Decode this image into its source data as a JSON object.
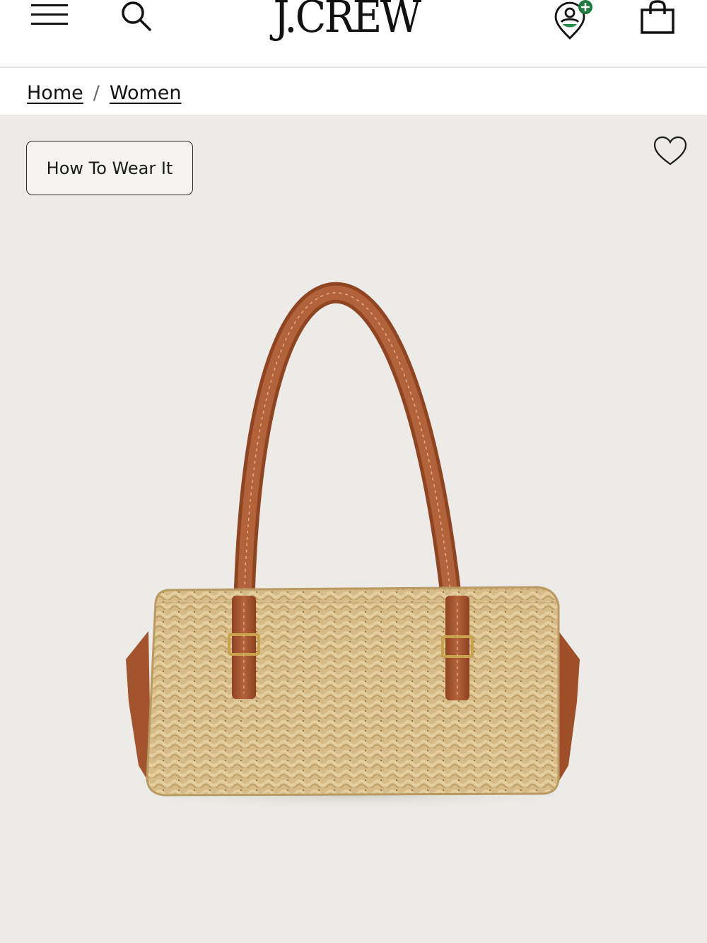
{
  "header": {
    "logo_text": "J.CREW",
    "menu_icon": "hamburger-menu-icon",
    "search_icon": "search-icon",
    "account_icon": "account-location-icon",
    "bag_icon": "shopping-bag-icon",
    "account_badge_color": "#1f7a3e"
  },
  "breadcrumb": {
    "items": [
      {
        "label": "Home"
      },
      {
        "label": "Women"
      }
    ],
    "separator": "/"
  },
  "product": {
    "how_to_wear_label": "How To Wear It",
    "wishlist_icon": "heart-icon",
    "image_alt": "straw-handbag-with-leather-handles",
    "colors": {
      "background": "#ecebe7",
      "straw": "#d9bf8c",
      "leather": "#a0532b"
    }
  }
}
